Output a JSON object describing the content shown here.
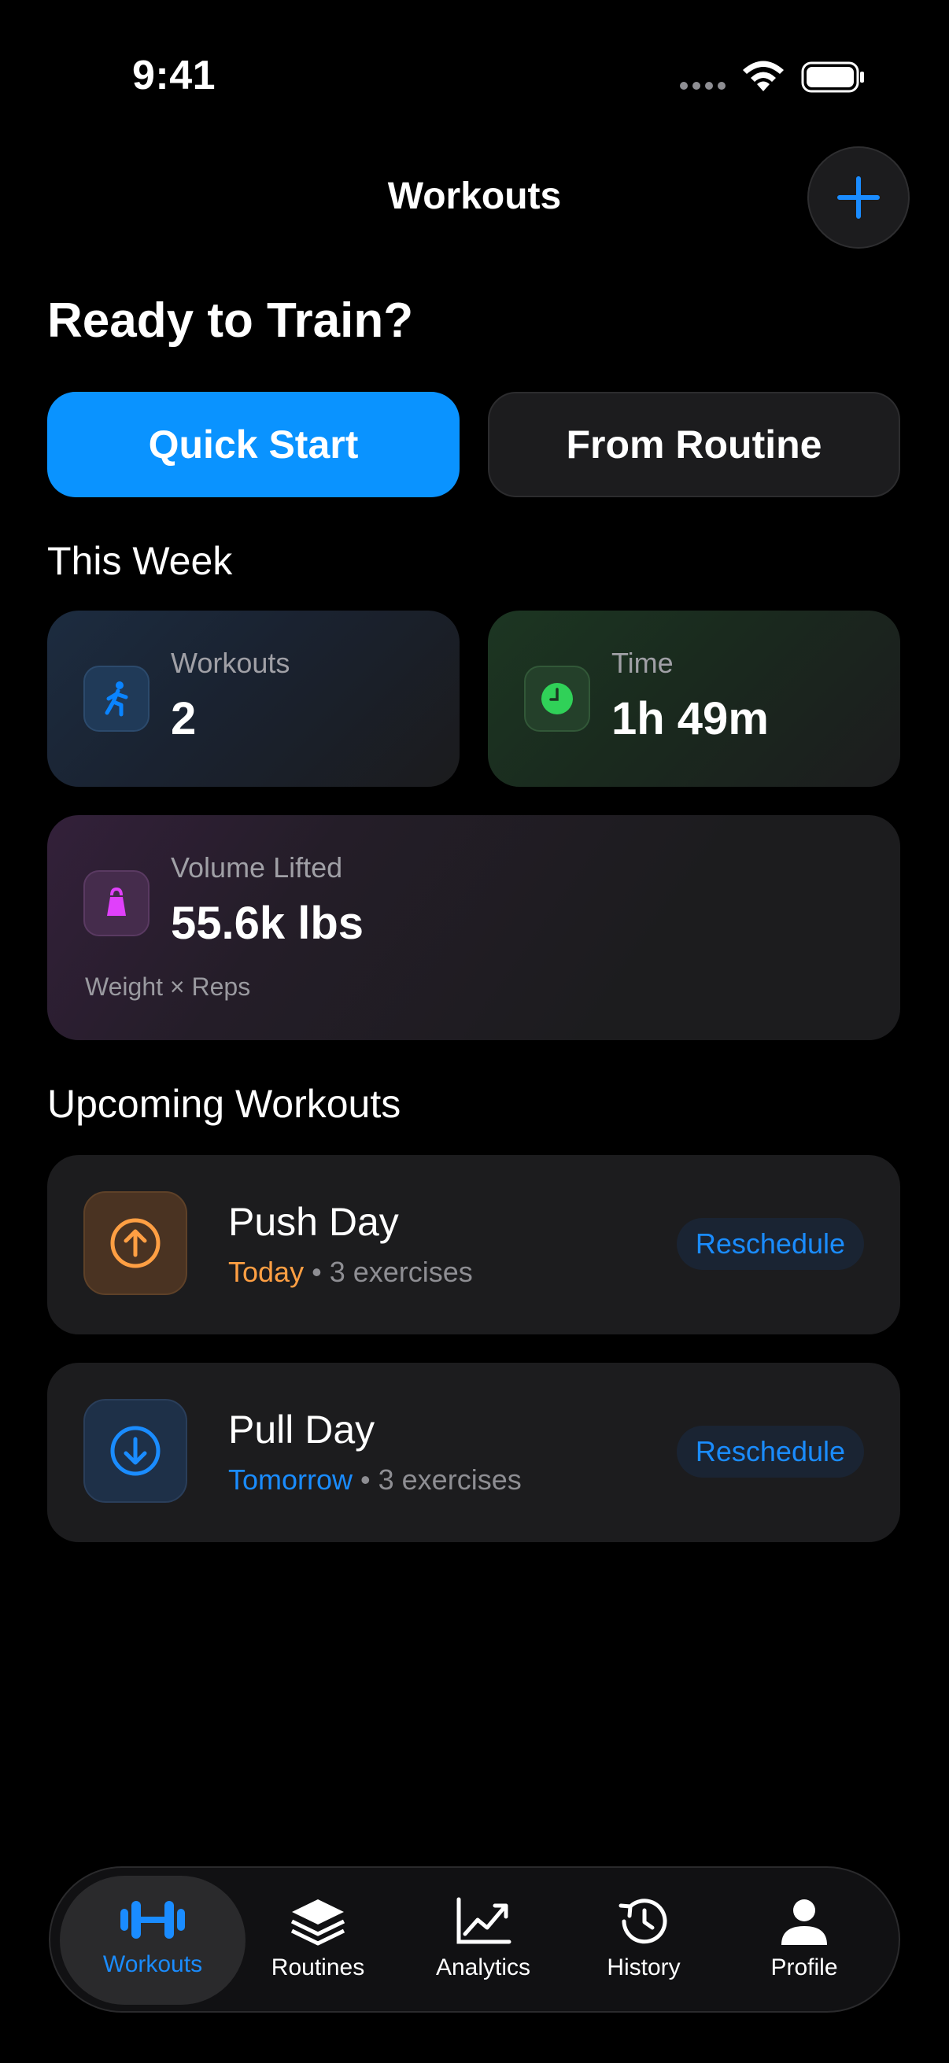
{
  "status": {
    "time": "9:41"
  },
  "header": {
    "title": "Workouts"
  },
  "hero": {
    "title": "Ready to Train?"
  },
  "actions": {
    "quick_start": "Quick Start",
    "from_routine": "From Routine"
  },
  "this_week": {
    "title": "This Week",
    "workouts": {
      "label": "Workouts",
      "value": "2",
      "icon": "running-figure-icon",
      "color": "#0a84ff"
    },
    "time": {
      "label": "Time",
      "value": "1h 49m",
      "icon": "clock-icon",
      "color": "#30d158"
    },
    "volume": {
      "label": "Volume Lifted",
      "value": "55.6k lbs",
      "note": "Weight × Reps",
      "icon": "kettlebell-icon",
      "color": "#e040fb"
    }
  },
  "upcoming": {
    "title": "Upcoming Workouts",
    "items": [
      {
        "name": "Push Day",
        "day": "Today",
        "separator": "•",
        "exercises": "3 exercises",
        "action": "Reschedule",
        "icon": "arrow-up-circle-icon",
        "color": "#ff9f43"
      },
      {
        "name": "Pull Day",
        "day": "Tomorrow",
        "separator": "•",
        "exercises": "3 exercises",
        "action": "Reschedule",
        "icon": "arrow-down-circle-icon",
        "color": "#1a8cff"
      }
    ]
  },
  "tabs": [
    {
      "label": "Workouts",
      "icon": "dumbbell-icon",
      "active": true
    },
    {
      "label": "Routines",
      "icon": "layers-icon",
      "active": false
    },
    {
      "label": "Analytics",
      "icon": "chart-line-icon",
      "active": false
    },
    {
      "label": "History",
      "icon": "history-clock-icon",
      "active": false
    },
    {
      "label": "Profile",
      "icon": "person-icon",
      "active": false
    }
  ],
  "colors": {
    "accent": "#0a93ff",
    "background": "#000000",
    "card": "#1c1c1e"
  }
}
